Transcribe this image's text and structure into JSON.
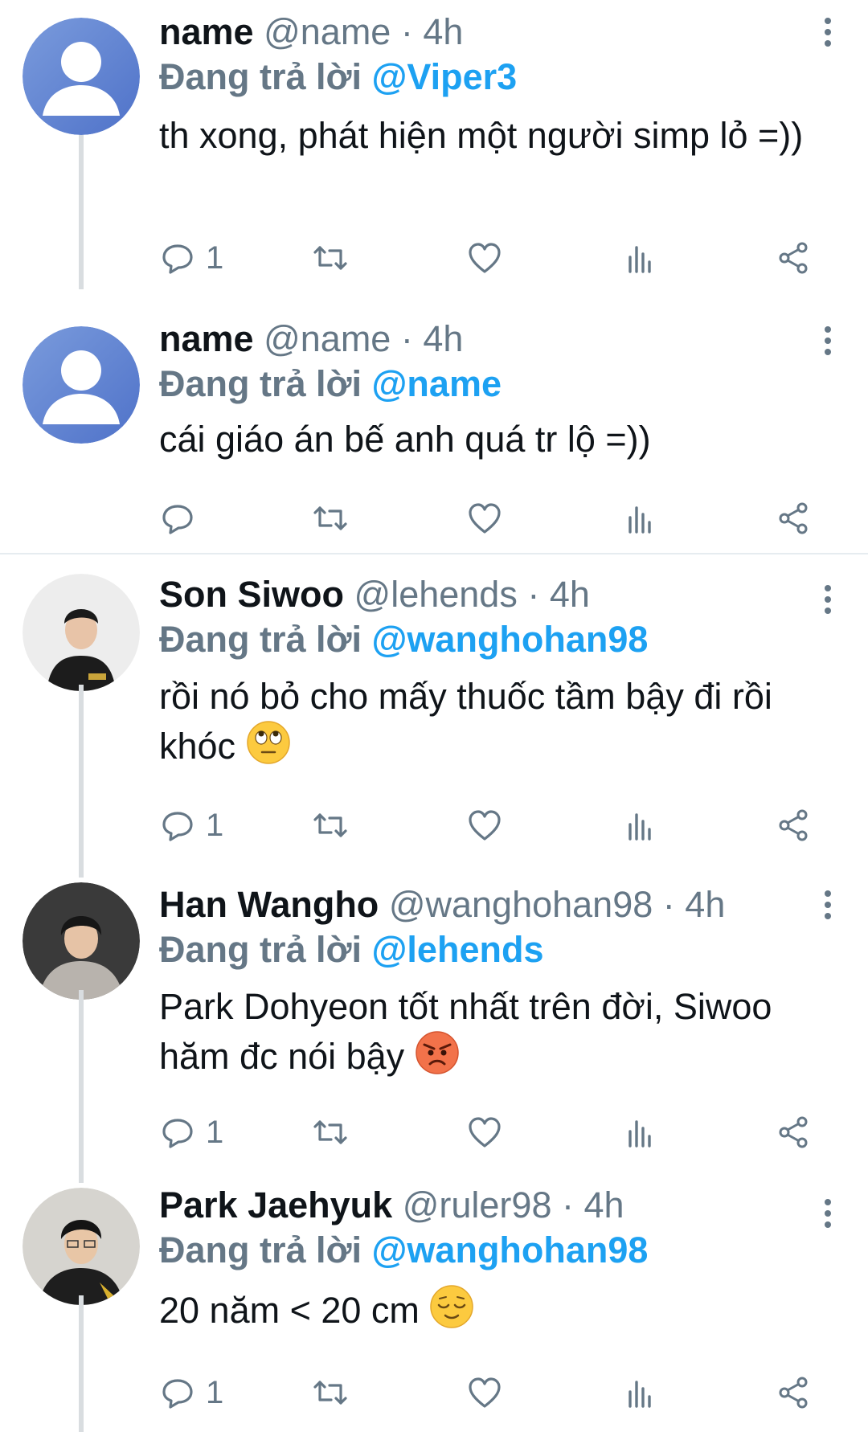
{
  "reply_prefix": "Đang trả lời",
  "tweets": [
    {
      "name": "name",
      "handle": "@name",
      "time": "4h",
      "reply_to": "@Viper3",
      "text": "th xong, phát hiện một người simp lỏ =))",
      "emoji": "",
      "reply_count": "1",
      "avatar": "default-avatar"
    },
    {
      "name": "name",
      "handle": "@name",
      "time": "4h",
      "reply_to": "@name",
      "text": "cái giáo án bế anh quá tr lộ =))",
      "emoji": "",
      "reply_count": "",
      "avatar": "default-avatar"
    },
    {
      "name": "Son Siwoo",
      "handle": "@lehends",
      "time": "4h",
      "reply_to": "@wanghohan98",
      "text": "rồi nó bỏ cho mấy thuốc tầm bậy đi rồi khóc",
      "emoji": "face-with-rolling-eyes",
      "reply_count": "1",
      "avatar": "photo-avatar"
    },
    {
      "name": "Han Wangho",
      "handle": "@wanghohan98",
      "time": "4h",
      "reply_to": "@lehends",
      "text": "Park Dohyeon tốt nhất trên đời, Siwoo hăm đc nói bậy",
      "emoji": "angry-face",
      "reply_count": "1",
      "avatar": "photo-avatar"
    },
    {
      "name": "Park Jaehyuk",
      "handle": "@ruler98",
      "time": "4h",
      "reply_to": "@wanghohan98",
      "text": "20 năm < 20 cm",
      "emoji": "relieved-face",
      "reply_count": "1",
      "avatar": "photo-avatar"
    }
  ]
}
